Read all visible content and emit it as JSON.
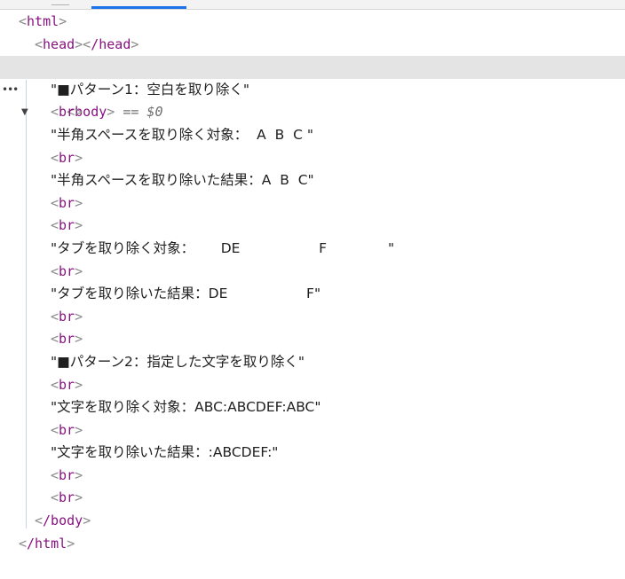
{
  "tags": {
    "html_open": "html",
    "head_open": "head",
    "head_close": "/head",
    "body_open": "body",
    "body_close": "/body",
    "html_close": "/html",
    "br": "br"
  },
  "selection": {
    "dots": "•••",
    "marker": "== $0"
  },
  "body_nodes": [
    {
      "type": "text",
      "value": "\"■パターン1：空白を取り除く\""
    },
    {
      "type": "br"
    },
    {
      "type": "text",
      "value": "\"半角スペースを取り除く対象：  A  B  C \""
    },
    {
      "type": "br"
    },
    {
      "type": "text",
      "value": "\"半角スペースを取り除いた結果：A  B  C\""
    },
    {
      "type": "br"
    },
    {
      "type": "br"
    },
    {
      "type": "text",
      "value": "\"タブを取り除く対象：      DE                  F              \""
    },
    {
      "type": "br"
    },
    {
      "type": "text",
      "value": "\"タブを取り除いた結果：DE                  F\""
    },
    {
      "type": "br"
    },
    {
      "type": "br"
    },
    {
      "type": "text",
      "value": "\"■パターン2：指定した文字を取り除く\""
    },
    {
      "type": "br"
    },
    {
      "type": "text",
      "value": "\"文字を取り除く対象：ABC:ABCDEF:ABC\""
    },
    {
      "type": "br"
    },
    {
      "type": "text",
      "value": "\"文字を取り除いた結果：:ABCDEF:\""
    },
    {
      "type": "br"
    },
    {
      "type": "br"
    }
  ]
}
